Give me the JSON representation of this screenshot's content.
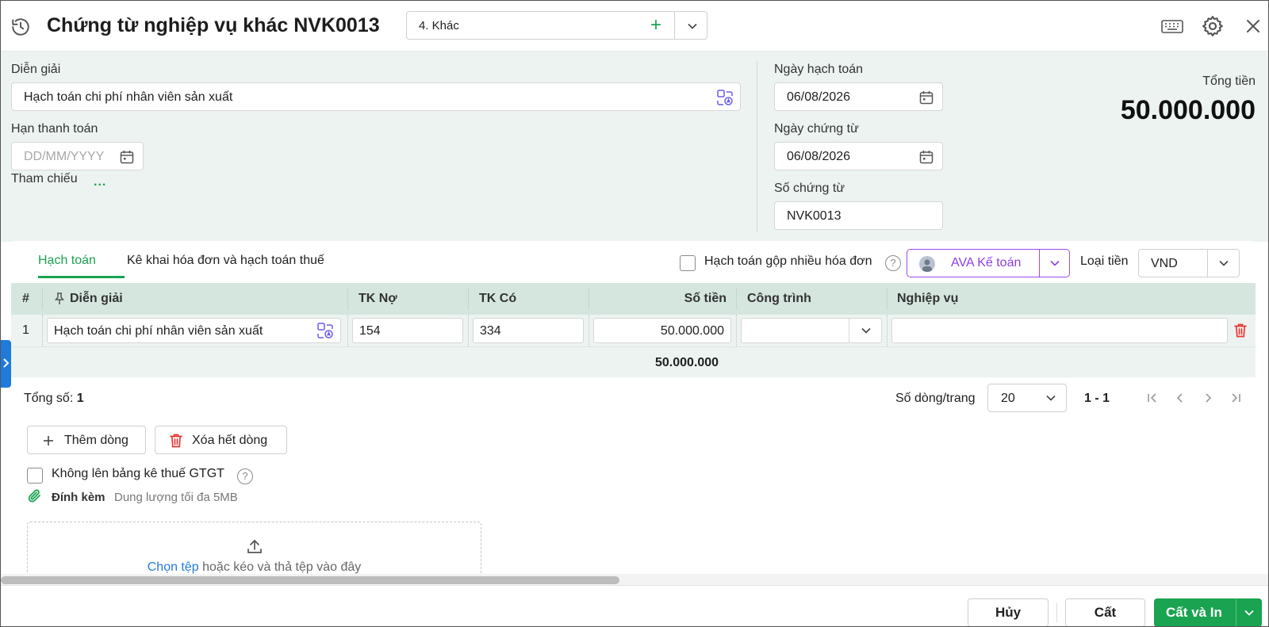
{
  "header": {
    "title": "Chứng từ nghiệp vụ khác NVK0013",
    "type_select_value": "4. Khác"
  },
  "form": {
    "dien_giai_label": "Diễn giải",
    "dien_giai_value": "Hạch toán chi phí nhân viên sản xuất",
    "han_thanh_toan_label": "Hạn thanh toán",
    "han_thanh_toan_placeholder": "DD/MM/YYYY",
    "tham_chieu_label": "Tham chiếu",
    "tham_chieu_more": "...",
    "ngay_hach_toan_label": "Ngày hạch toán",
    "ngay_hach_toan_value": "06/08/2026",
    "ngay_chung_tu_label": "Ngày chứng từ",
    "ngay_chung_tu_value": "06/08/2026",
    "so_chung_tu_label": "Số chứng từ",
    "so_chung_tu_value": "NVK0013",
    "tong_tien_label": "Tổng tiền",
    "tong_tien_value": "50.000.000"
  },
  "tabs": [
    {
      "label": "Hạch toán",
      "active": true
    },
    {
      "label": "Kê khai hóa đơn và hạch toán thuế",
      "active": false
    }
  ],
  "toolbar": {
    "gop_hoa_don_label": "Hạch toán gộp nhiều hóa đơn",
    "ava_label": "AVA Kế toán",
    "loai_tien_label": "Loại tiền",
    "loai_tien_value": "VND"
  },
  "table": {
    "columns": [
      "#",
      "Diễn giải",
      "TK Nợ",
      "TK Có",
      "Số tiền",
      "Công trình",
      "Nghiệp vụ"
    ],
    "rows": [
      {
        "no": "1",
        "dien_giai": "Hạch toán chi phí nhân viên sản xuất",
        "tk_no": "154",
        "tk_co": "334",
        "so_tien": "50.000.000",
        "cong_trinh": "",
        "nghiep_vu": ""
      }
    ],
    "total_so_tien": "50.000.000"
  },
  "pagination": {
    "tong_so_label": "Tổng số:",
    "tong_so_value": "1",
    "rows_per_page_label": "Số dòng/trang",
    "rows_per_page_value": "20",
    "range": "1 - 1"
  },
  "actions": {
    "add_row": "Thêm dòng",
    "delete_all": "Xóa hết dòng",
    "vat_checkbox_label": "Không lên bảng kê thuế GTGT"
  },
  "attachments": {
    "label": "Đính kèm",
    "hint": "Dung lượng tối đa 5MB",
    "choose_link": "Chọn tệp",
    "drop_text": " hoặc kéo và thả tệp vào đây"
  },
  "footer": {
    "cancel": "Hủy",
    "save": "Cất",
    "save_print": "Cất và In"
  },
  "colors": {
    "accent": "#1aa350",
    "ava": "#8c3fe8",
    "danger": "#e53935",
    "panel": "#ecf3f0",
    "table_header": "#d5e6df"
  }
}
